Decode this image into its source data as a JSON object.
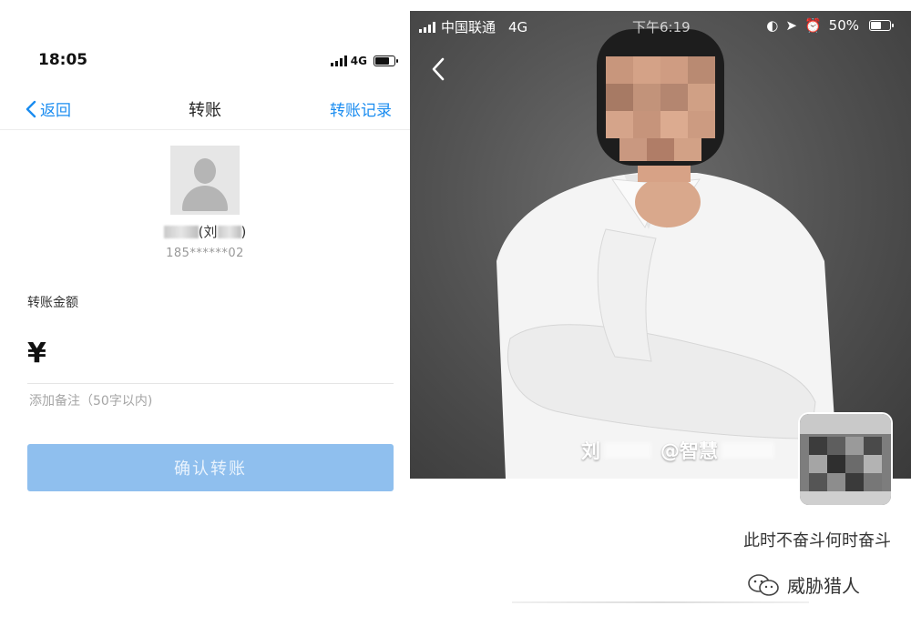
{
  "left_screen": {
    "status_bar": {
      "time": "18:05",
      "network": "4G",
      "battery_level": 0.7
    },
    "navbar": {
      "back_label": "返回",
      "title": "转账",
      "history_label": "转账记录"
    },
    "recipient": {
      "name_open": "(刘",
      "name_close": ")",
      "phone": "185******02"
    },
    "amount_label": "转账金额",
    "currency_symbol": "¥",
    "note_placeholder": "添加备注（50字以内)",
    "confirm_label": "确认转账"
  },
  "right_screen": {
    "status_bar": {
      "carrier": "中国联通",
      "network": "4G",
      "clock": "下午6:19",
      "battery": "50%",
      "battery_level": 0.5
    },
    "photo_caption": {
      "prefix": "刘",
      "at": "@智慧"
    },
    "motto": "此时不奋斗何时奋斗"
  },
  "footer": {
    "brand": "威胁猎人"
  },
  "icons": [
    "back-chevron-icon",
    "signal-icon",
    "battery-icon",
    "default-avatar-icon",
    "location-icon",
    "alarm-icon",
    "wechat-icon"
  ]
}
